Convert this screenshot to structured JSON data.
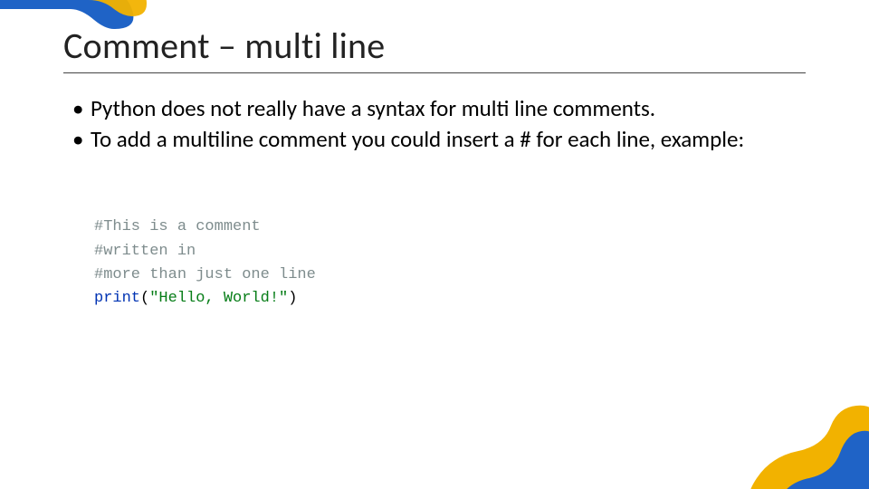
{
  "title": "Comment – multi line",
  "bullets": [
    "Python does not really have a syntax for multi line comments.",
    "To add a multiline comment you could insert a # for each line, example:"
  ],
  "code": {
    "line1": "#This is a comment",
    "line2": "#written in",
    "line3": "#more than just one line",
    "line4_func": "print",
    "line4_paren_open": "(",
    "line4_string": "\"Hello, World!\"",
    "line4_paren_close": ")"
  },
  "decor": {
    "top_fill_1": "#1f63c6",
    "top_fill_2": "#f2b200",
    "bottom_fill_1": "#f2b200",
    "bottom_fill_2": "#1f63c6"
  }
}
